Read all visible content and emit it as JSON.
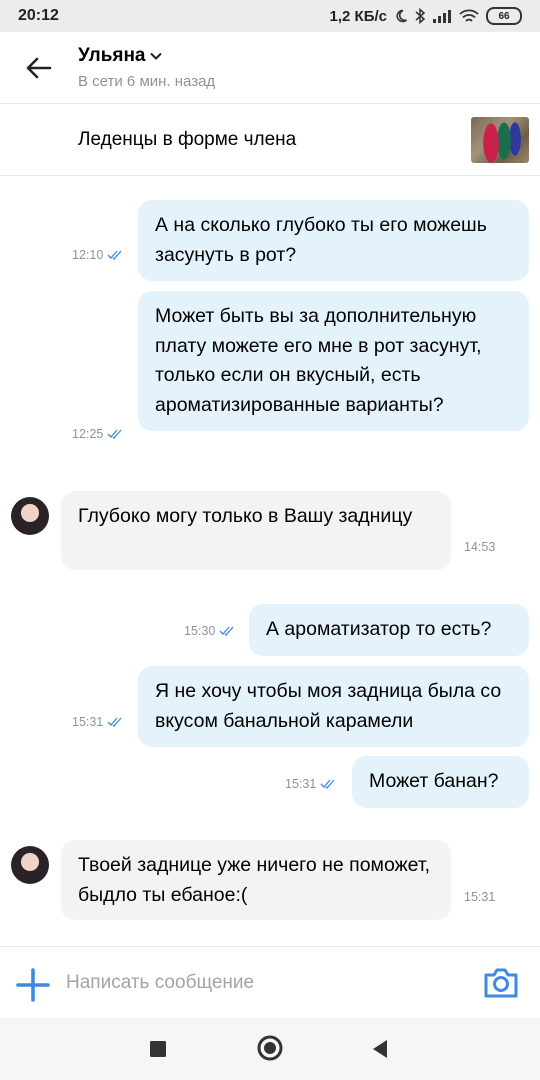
{
  "status_bar": {
    "time": "20:12",
    "speed": "1,2 КБ/с",
    "battery": "66"
  },
  "header": {
    "name": "Ульяна",
    "status": "В сети 6 мин. назад"
  },
  "product": {
    "title": "Леденцы в форме члена"
  },
  "messages": [
    {
      "dir": "out",
      "text": "А на сколько глубоко ты его можешь засунуть в рот?",
      "time": "12:10"
    },
    {
      "dir": "out",
      "text": "Может быть вы за дополнительную плату можете его мне в рот засунут, только если он вкусный, есть ароматизированные варианты?",
      "time": "12:25"
    },
    {
      "dir": "in",
      "text": "Глубоко могу только в Вашу задницу",
      "time": "14:53"
    },
    {
      "dir": "out",
      "text": "А ароматизатор то есть?",
      "time": "15:30"
    },
    {
      "dir": "out",
      "text": "Я не хочу чтобы моя задница была со вкусом банальной карамели",
      "time": "15:31"
    },
    {
      "dir": "out",
      "text": "Может банан?",
      "time": "15:31"
    },
    {
      "dir": "in",
      "text": "Твоей заднице уже ничего не поможет, быдло ты ебаное:(",
      "time": "15:31"
    }
  ],
  "composer": {
    "placeholder": "Написать сообщение"
  },
  "colors": {
    "accent": "#3f8ae0",
    "outgoing_bubble": "#e4f2fc",
    "incoming_bubble": "#f2f3f5",
    "secondary_text": "#8d939b"
  },
  "icons": {
    "back": "arrow-left-icon",
    "dropdown": "chevron-down-icon",
    "read": "double-check-icon",
    "attach": "plus-icon",
    "camera": "camera-icon",
    "nav_recents": "square-icon",
    "nav_home": "circle-icon",
    "nav_back": "triangle-back-icon"
  }
}
